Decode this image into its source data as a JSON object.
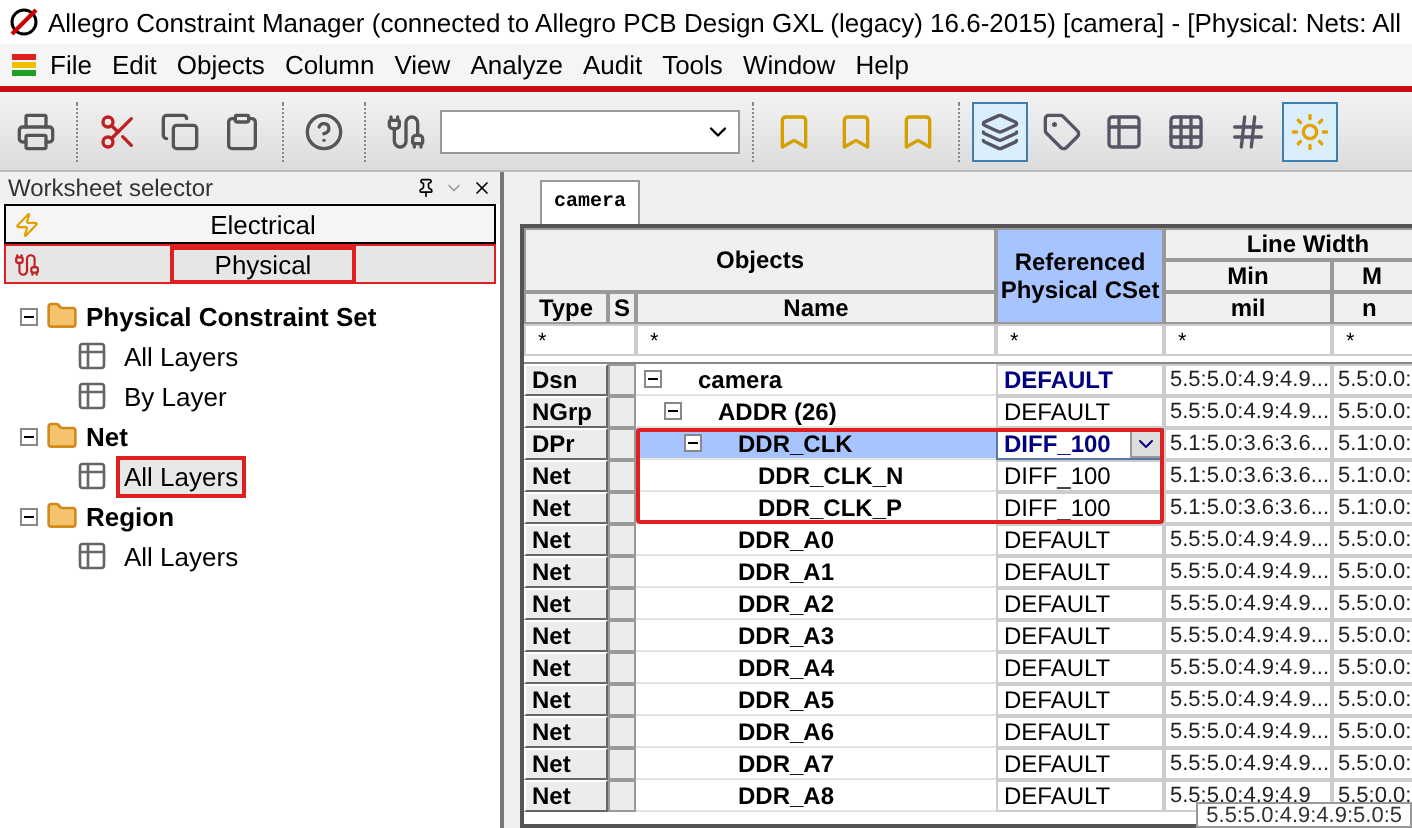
{
  "window": {
    "title": "Allegro Constraint Manager (connected to Allegro PCB Design GXL (legacy) 16.6-2015) [camera] - [Physical:  Nets:  All"
  },
  "menu": [
    "File",
    "Edit",
    "Objects",
    "Column",
    "View",
    "Analyze",
    "Audit",
    "Tools",
    "Window",
    "Help"
  ],
  "toolbar": {
    "toggles": [
      {
        "selected": true
      },
      {
        "selected": false
      },
      {
        "selected": false
      },
      {
        "selected": false
      },
      {
        "selected": false
      },
      {
        "selected": true
      }
    ]
  },
  "worksheet_selector": {
    "title": "Worksheet selector",
    "worksheets": [
      {
        "label": "Electrical",
        "selected": false,
        "highlighted": false
      },
      {
        "label": "Physical",
        "selected": true,
        "highlighted": true
      }
    ],
    "tree": [
      {
        "label": "Physical Constraint Set",
        "expanded": true,
        "children": [
          {
            "label": "All Layers",
            "selected": false,
            "highlighted": false
          },
          {
            "label": "By Layer",
            "selected": false,
            "highlighted": false
          }
        ]
      },
      {
        "label": "Net",
        "expanded": true,
        "children": [
          {
            "label": "All Layers",
            "selected": true,
            "highlighted": true
          }
        ]
      },
      {
        "label": "Region",
        "expanded": true,
        "children": [
          {
            "label": "All Layers",
            "selected": false,
            "highlighted": false
          }
        ]
      }
    ]
  },
  "tabs": [
    {
      "label": "camera",
      "selected": true
    }
  ],
  "table": {
    "header": {
      "objects": "Objects",
      "type": "Type",
      "s": "S",
      "name": "Name",
      "cset": "Referenced Physical CSet",
      "group": "Line Width",
      "min": "Min",
      "min_unit": "mil",
      "column_6": "M",
      "column_6_unit": "n"
    },
    "filters": [
      "*",
      "*",
      "*",
      "*",
      "*"
    ],
    "rows": [
      {
        "type": "Dsn",
        "name": "camera",
        "cset": "DEFAULT",
        "cset_emphasis": true,
        "min": "5.5:5.0:4.9:4.9...",
        "column_6": "5.5:0.0:",
        "selected": false,
        "editing": false,
        "highlighted": false,
        "expanded": true,
        "children": [
          {
            "type": "NGrp",
            "name": "ADDR (26)",
            "cset": "DEFAULT",
            "cset_emphasis": false,
            "min": "5.5:5.0:4.9:4.9...",
            "column_6": "5.5:0.0:",
            "selected": false,
            "editing": false,
            "highlighted": false,
            "expanded": true,
            "children": [
              {
                "type": "DPr",
                "name": "DDR_CLK",
                "cset": "DIFF_100",
                "cset_emphasis": true,
                "min": "5.1:5.0:3.6:3.6...",
                "column_6": "5.1:0.0:",
                "selected": true,
                "editing": true,
                "highlighted": true,
                "expanded": true,
                "children": [
                  {
                    "type": "Net",
                    "name": "DDR_CLK_N",
                    "cset": "DIFF_100",
                    "cset_emphasis": false,
                    "min": "5.1:5.0:3.6:3.6...",
                    "column_6": "5.1:0.0:",
                    "selected": false,
                    "editing": false,
                    "highlighted": true
                  },
                  {
                    "type": "Net",
                    "name": "DDR_CLK_P",
                    "cset": "DIFF_100",
                    "cset_emphasis": false,
                    "min": "5.1:5.0:3.6:3.6...",
                    "column_6": "5.1:0.0:",
                    "selected": false,
                    "editing": false,
                    "highlighted": true
                  }
                ]
              },
              {
                "type": "Net",
                "name": "DDR_A0",
                "cset": "DEFAULT",
                "cset_emphasis": false,
                "min": "5.5:5.0:4.9:4.9...",
                "column_6": "5.5:0.0:",
                "selected": false,
                "editing": false,
                "highlighted": false
              },
              {
                "type": "Net",
                "name": "DDR_A1",
                "cset": "DEFAULT",
                "cset_emphasis": false,
                "min": "5.5:5.0:4.9:4.9...",
                "column_6": "5.5:0.0:",
                "selected": false,
                "editing": false,
                "highlighted": false
              },
              {
                "type": "Net",
                "name": "DDR_A2",
                "cset": "DEFAULT",
                "cset_emphasis": false,
                "min": "5.5:5.0:4.9:4.9...",
                "column_6": "5.5:0.0:",
                "selected": false,
                "editing": false,
                "highlighted": false
              },
              {
                "type": "Net",
                "name": "DDR_A3",
                "cset": "DEFAULT",
                "cset_emphasis": false,
                "min": "5.5:5.0:4.9:4.9...",
                "column_6": "5.5:0.0:",
                "selected": false,
                "editing": false,
                "highlighted": false
              },
              {
                "type": "Net",
                "name": "DDR_A4",
                "cset": "DEFAULT",
                "cset_emphasis": false,
                "min": "5.5:5.0:4.9:4.9...",
                "column_6": "5.5:0.0:",
                "selected": false,
                "editing": false,
                "highlighted": false
              },
              {
                "type": "Net",
                "name": "DDR_A5",
                "cset": "DEFAULT",
                "cset_emphasis": false,
                "min": "5.5:5.0:4.9:4.9...",
                "column_6": "5.5:0.0:",
                "selected": false,
                "editing": false,
                "highlighted": false
              },
              {
                "type": "Net",
                "name": "DDR_A6",
                "cset": "DEFAULT",
                "cset_emphasis": false,
                "min": "5.5:5.0:4.9:4.9...",
                "column_6": "5.5:0.0:",
                "selected": false,
                "editing": false,
                "highlighted": false
              },
              {
                "type": "Net",
                "name": "DDR_A7",
                "cset": "DEFAULT",
                "cset_emphasis": false,
                "min": "5.5:5.0:4.9:4.9...",
                "column_6": "5.5:0.0:",
                "selected": false,
                "editing": false,
                "highlighted": false
              },
              {
                "type": "Net",
                "name": "DDR_A8",
                "cset": "DEFAULT",
                "cset_emphasis": false,
                "min": "5.5:5.0:4.9:4.9",
                "column_6": "5.5:0.0:",
                "selected": false,
                "editing": false,
                "highlighted": false
              }
            ]
          }
        ]
      }
    ]
  },
  "tooltip": "5.5:5.0:4.9:4.9:5.0:5"
}
